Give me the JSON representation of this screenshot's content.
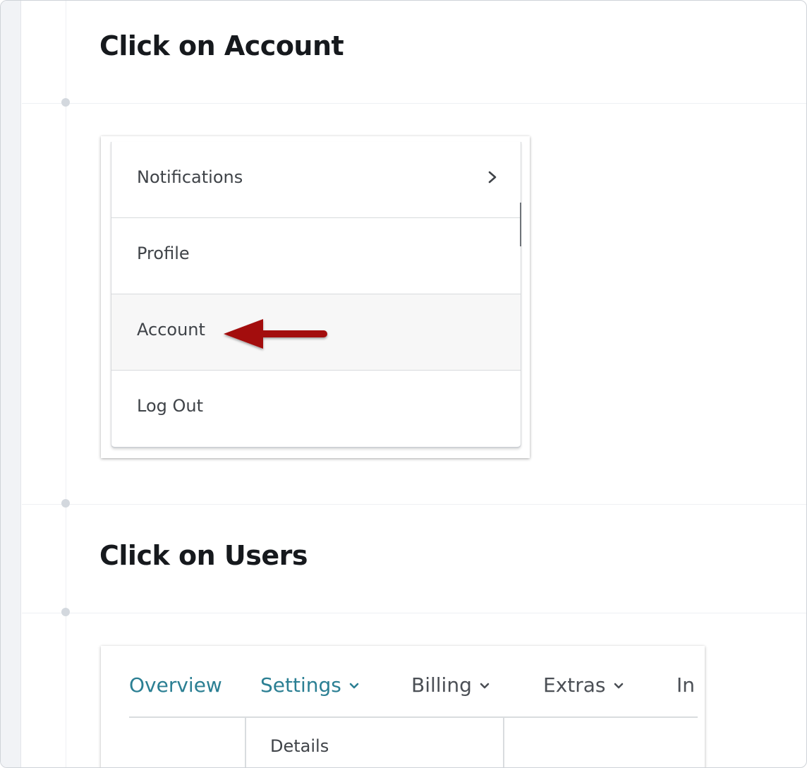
{
  "steps": [
    {
      "title": "Click on Account"
    },
    {
      "title": "Click on Users"
    }
  ],
  "menu": {
    "items": [
      {
        "label": "Notifications",
        "has_submenu": true,
        "icon": "chevron-right-icon"
      },
      {
        "label": "Profile"
      },
      {
        "label": "Account",
        "highlighted": true
      },
      {
        "label": "Log Out"
      }
    ]
  },
  "nav": {
    "tabs": [
      {
        "label": "Overview",
        "active": true
      },
      {
        "label": "Settings",
        "active": true,
        "dropdown": true
      },
      {
        "label": "Billing",
        "dropdown": true
      },
      {
        "label": "Extras",
        "dropdown": true
      },
      {
        "label": "In"
      }
    ],
    "submenu": {
      "first_item": "Details"
    }
  },
  "colors": {
    "arrow": "#a30d10",
    "active_tab": "#2b7f93",
    "text": "#16191d"
  }
}
